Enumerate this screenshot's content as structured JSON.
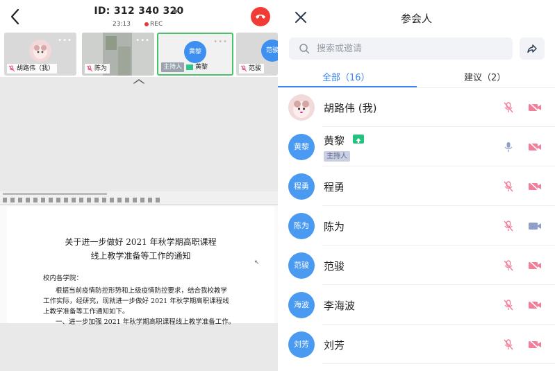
{
  "left": {
    "meeting_id": "ID: 312 340 320",
    "timer": "23:13",
    "rec": "REC",
    "thumbnails": [
      {
        "name": "胡路伟（我）"
      },
      {
        "name": "陈为"
      },
      {
        "host_tag": "主持人",
        "name": "黄黎",
        "avatar": "黄黎"
      },
      {
        "name": "范骏",
        "avatar": "范骏"
      }
    ],
    "document": {
      "title_line1": "关于进一步做好 2021 年秋学期高职课程",
      "title_line2": "线上教学准备等工作的通知",
      "greeting": "校内各学院：",
      "para1_line1": "根据当前疫情防控形势和上级疫情防控要求，结合我校教学",
      "para1_line2": "工作实际，经研究，现就进一步做好 2021 年秋学期高职课程线",
      "para1_line3": "上教学准备等工作通知如下。",
      "para2_line1": "一、进一步加强 2021 年秋学期高职课程线上教学准备工作。"
    }
  },
  "right": {
    "title": "参会人",
    "search_placeholder": "搜索或邀请",
    "tabs": [
      {
        "label": "全部（16）",
        "active": true
      },
      {
        "label": "建议（2）",
        "active": false
      }
    ],
    "participants": [
      {
        "avatar": "",
        "photo": true,
        "name": "胡路伟 (我)",
        "mic": "muted",
        "cam": "off"
      },
      {
        "avatar": "黄黎",
        "name": "黄黎",
        "host": "主持人",
        "sharing": true,
        "mic": "on",
        "cam": "off"
      },
      {
        "avatar": "程勇",
        "name": "程勇",
        "mic": "muted",
        "cam": "off"
      },
      {
        "avatar": "陈为",
        "name": "陈为",
        "mic": "muted",
        "cam": "on"
      },
      {
        "avatar": "范骏",
        "name": "范骏",
        "mic": "muted",
        "cam": "off"
      },
      {
        "avatar": "海波",
        "name": "李海波",
        "mic": "muted",
        "cam": "off"
      },
      {
        "avatar": "刘芳",
        "name": "刘芳",
        "mic": "muted",
        "cam": "off"
      }
    ]
  },
  "colors": {
    "accent": "#3a84f0",
    "avatar_blue": "#4a9af2",
    "muted_pink": "#f27e9a",
    "active_blue": "#8f9fc7",
    "host_green": "#23c27d",
    "hangup_red": "#f03c35"
  }
}
